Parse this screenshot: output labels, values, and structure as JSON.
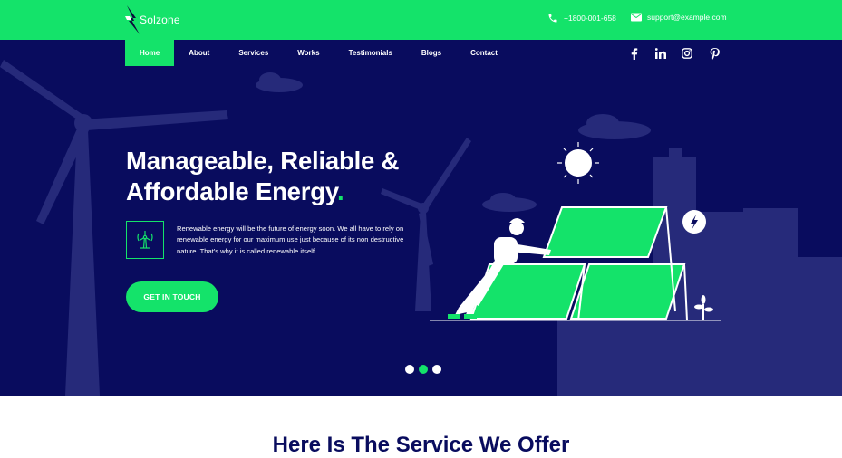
{
  "brand": {
    "name": "Solzone"
  },
  "topbar": {
    "phone": "+1800-001-658",
    "email": "support@example.com"
  },
  "nav": {
    "items": [
      {
        "label": "Home"
      },
      {
        "label": "About"
      },
      {
        "label": "Services"
      },
      {
        "label": "Works"
      },
      {
        "label": "Testimonials"
      },
      {
        "label": "Blogs"
      },
      {
        "label": "Contact"
      }
    ],
    "active": "Home"
  },
  "social": [
    "facebook-icon",
    "linkedin-icon",
    "instagram-icon",
    "pinterest-icon"
  ],
  "hero": {
    "headline_line1": "Manageable, Reliable &",
    "headline_line2": "Affordable Energy",
    "headline_dot": ".",
    "description": "Renewable energy will be the future of energy soon. We all have to rely on renewable energy for our maximum use just because of its non destructive nature. That's why it is called renewable itself.",
    "cta_label": "GET IN TOUCH",
    "slides_total": 3,
    "slide_active": 2
  },
  "section": {
    "title": "Here Is The Service We Offer"
  },
  "colors": {
    "accent": "#14e36a",
    "navy": "#090c5e",
    "white": "#ffffff"
  }
}
